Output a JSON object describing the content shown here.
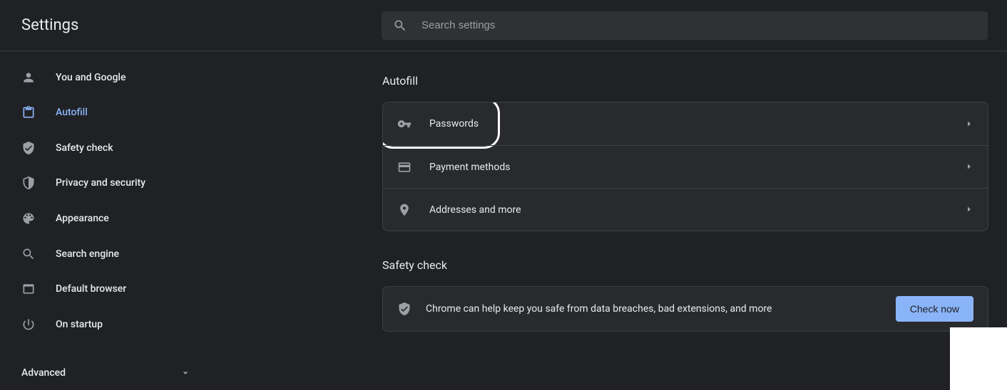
{
  "header": {
    "title": "Settings",
    "search_placeholder": "Search settings"
  },
  "sidebar": {
    "items": [
      {
        "label": "You and Google"
      },
      {
        "label": "Autofill"
      },
      {
        "label": "Safety check"
      },
      {
        "label": "Privacy and security"
      },
      {
        "label": "Appearance"
      },
      {
        "label": "Search engine"
      },
      {
        "label": "Default browser"
      },
      {
        "label": "On startup"
      }
    ],
    "advanced_label": "Advanced"
  },
  "main": {
    "autofill": {
      "title": "Autofill",
      "rows": [
        {
          "label": "Passwords"
        },
        {
          "label": "Payment methods"
        },
        {
          "label": "Addresses and more"
        }
      ]
    },
    "safety": {
      "title": "Safety check",
      "text": "Chrome can help keep you safe from data breaches, bad extensions, and more",
      "button": "Check now"
    }
  }
}
